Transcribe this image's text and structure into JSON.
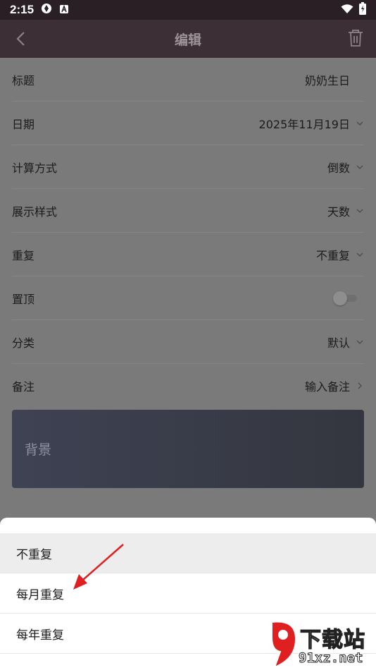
{
  "status_bar": {
    "time": "2:15"
  },
  "toolbar": {
    "title": "编辑"
  },
  "rows": [
    {
      "label": "标题",
      "value": "奶奶生日"
    },
    {
      "label": "日期",
      "value": "2025年11月19日"
    },
    {
      "label": "计算方式",
      "value": "倒数"
    },
    {
      "label": "展示样式",
      "value": "天数"
    },
    {
      "label": "重复",
      "value": "不重复"
    },
    {
      "label": "置顶",
      "value": ""
    },
    {
      "label": "分类",
      "value": "默认"
    },
    {
      "label": "备注",
      "value": "输入备注"
    }
  ],
  "background_card": {
    "label": "背景"
  },
  "repeat_sheet": {
    "options": [
      "不重复",
      "每月重复",
      "每年重复"
    ],
    "selected": "不重复"
  },
  "watermark": {
    "text": "下载站",
    "url": "91xz.net"
  },
  "colors": {
    "toolbar": "#3d2f36",
    "annotation_arrow": "#e02020"
  }
}
